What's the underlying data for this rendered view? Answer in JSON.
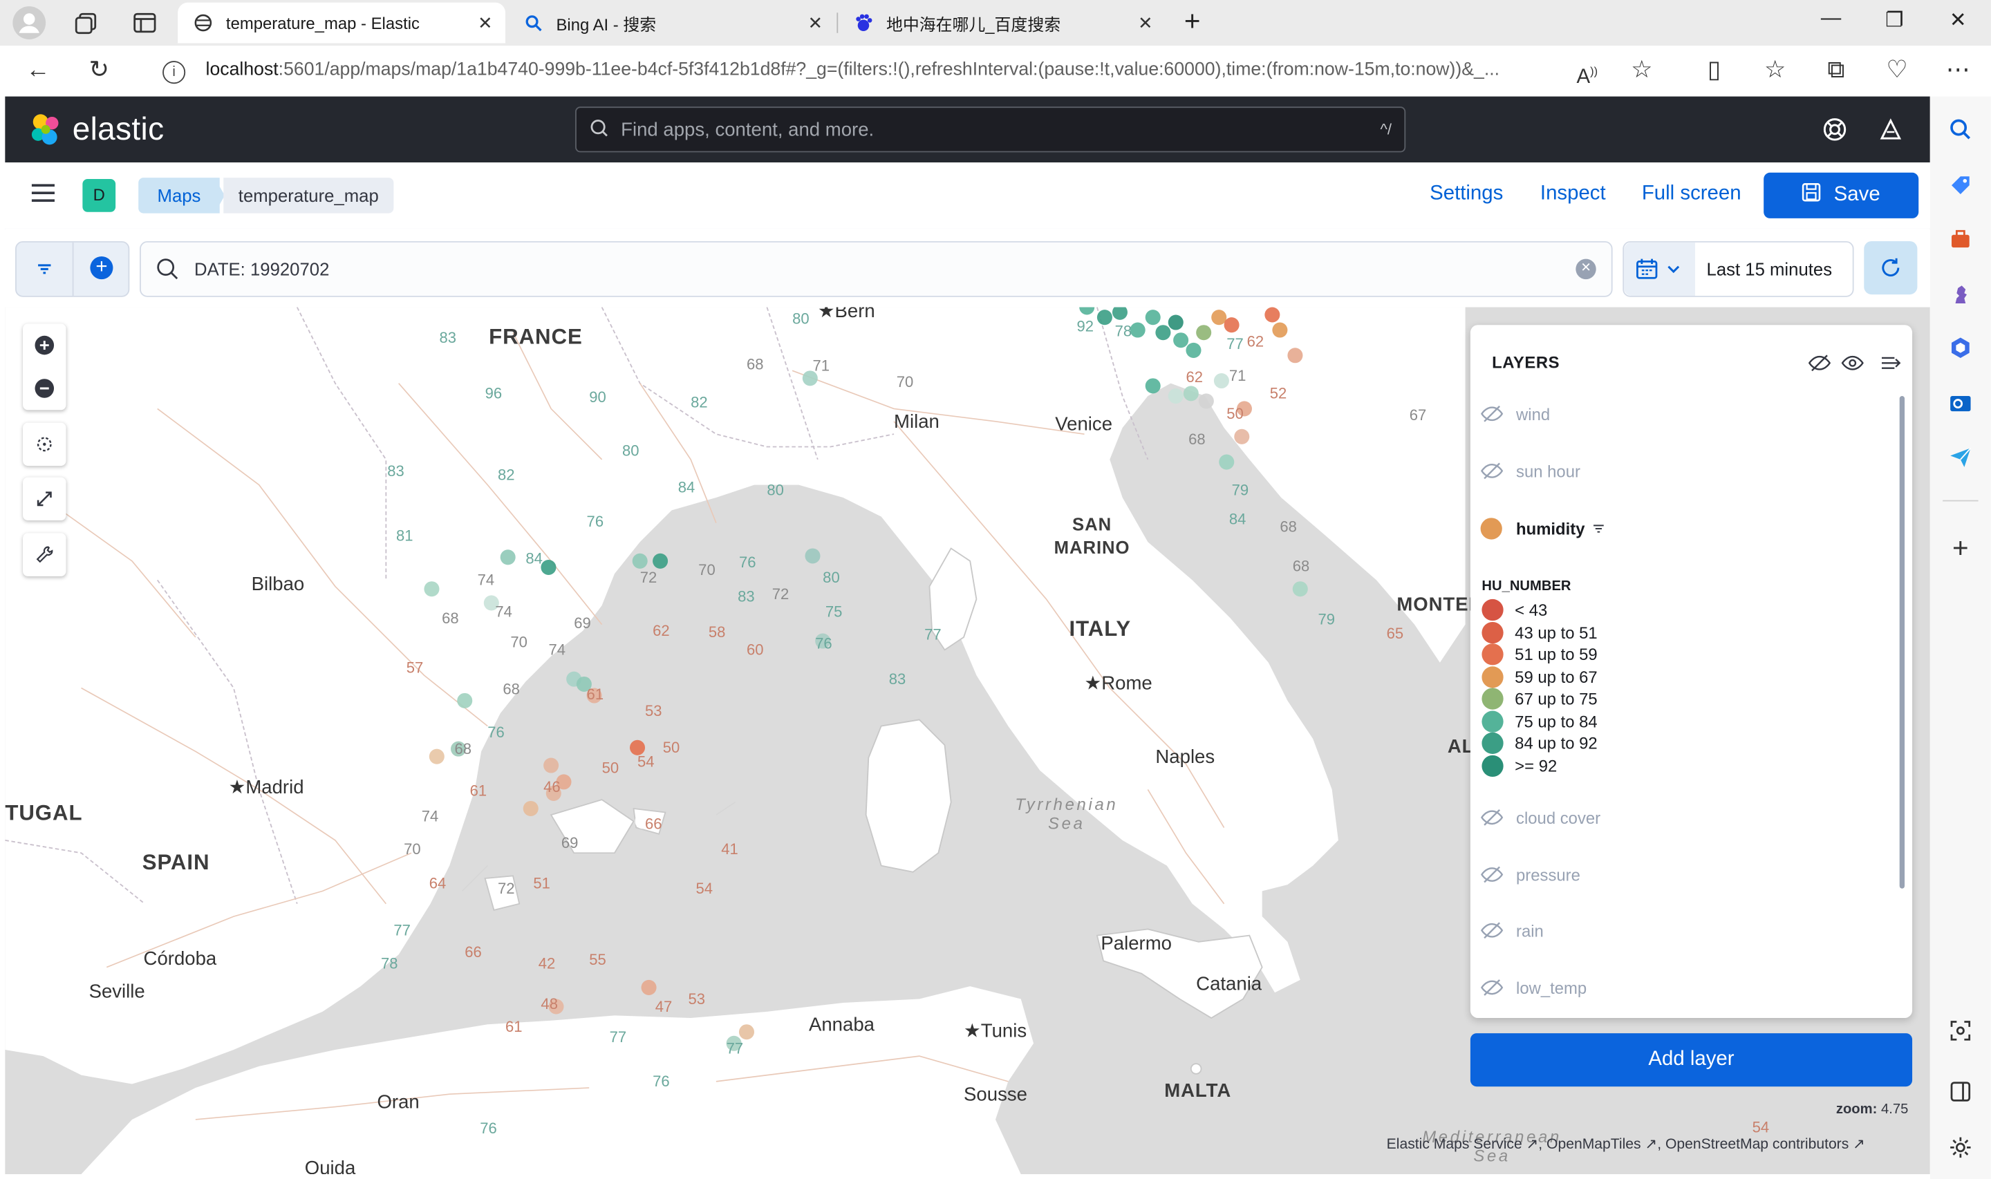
{
  "browser": {
    "tabs": [
      {
        "title": "temperature_map - Elastic",
        "active": true
      },
      {
        "title": "Bing AI - 搜索",
        "active": false
      },
      {
        "title": "地中海在哪儿_百度搜索",
        "active": false
      }
    ],
    "url_host": "localhost",
    "url_rest": ":5601/app/maps/map/1a1b4740-999b-11ee-b4cf-5f3f412b1d8f#?_g=(filters:!(),refreshInterval:(pause:!t,value:60000),time:(from:now-15m,to:now))&_..."
  },
  "kibana": {
    "brand": "elastic",
    "search_placeholder": "Find apps, content, and more.",
    "search_shortcut": "^/",
    "space_initial": "D",
    "breadcrumbs": [
      "Maps",
      "temperature_map"
    ],
    "actions": {
      "settings": "Settings",
      "inspect": "Inspect",
      "fullscreen": "Full screen",
      "save": "Save"
    },
    "query": "DATE: 19920702",
    "time_range": "Last 15 minutes",
    "accent": "#0b64dd"
  },
  "map": {
    "places": [
      {
        "name": "FRANCE",
        "big": true
      },
      {
        "name": "Bern"
      },
      {
        "name": "Milan"
      },
      {
        "name": "Venice"
      },
      {
        "name": "SAN MARINO",
        "big": true
      },
      {
        "name": "ITALY",
        "big": true
      },
      {
        "name": "Rome"
      },
      {
        "name": "Naples"
      },
      {
        "name": "MONTEN",
        "big": true
      },
      {
        "name": "AL",
        "big": true
      },
      {
        "name": "Bilbao"
      },
      {
        "name": "Madrid"
      },
      {
        "name": "TUGAL",
        "big": true
      },
      {
        "name": "SPAIN",
        "big": true
      },
      {
        "name": "Córdoba"
      },
      {
        "name": "Seville"
      },
      {
        "name": "Oran"
      },
      {
        "name": "Oujda"
      },
      {
        "name": "Annaba"
      },
      {
        "name": "Tunis"
      },
      {
        "name": "Sousse"
      },
      {
        "name": "Palermo"
      },
      {
        "name": "Catania"
      },
      {
        "name": "MALTA",
        "big": true
      }
    ],
    "seas": [
      {
        "name": "Tyrrhenian Sea"
      },
      {
        "name": "Mediterranean Sea"
      }
    ],
    "numbers": [
      "83",
      "80",
      "96",
      "90",
      "82",
      "68",
      "71",
      "70",
      "81",
      "83",
      "82",
      "80",
      "84",
      "80",
      "76",
      "84",
      "74",
      "68",
      "74",
      "70",
      "74",
      "69",
      "72",
      "70",
      "76",
      "83",
      "72",
      "80",
      "75",
      "62",
      "58",
      "60",
      "76",
      "77",
      "83",
      "57",
      "68",
      "61",
      "53",
      "50",
      "54",
      "50",
      "68",
      "76",
      "74",
      "61",
      "46",
      "69",
      "66",
      "41",
      "70",
      "64",
      "72",
      "51",
      "54",
      "77",
      "78",
      "66",
      "42",
      "55",
      "48",
      "47",
      "53",
      "61",
      "77",
      "77",
      "76",
      "76",
      "62",
      "71",
      "50",
      "52",
      "67",
      "68",
      "79",
      "84",
      "68",
      "68",
      "79",
      "65",
      "78",
      "77",
      "62",
      "92",
      "54"
    ],
    "zoom_label": "zoom:",
    "zoom_value": "4.75",
    "attribution": [
      "Elastic Maps Service",
      "OpenMapTiles",
      "OpenStreetMap contributors"
    ]
  },
  "layers_panel": {
    "title": "LAYERS",
    "layers": [
      {
        "name": "wind",
        "visible": false
      },
      {
        "name": "sun hour",
        "visible": false
      },
      {
        "name": "humidity",
        "visible": true
      },
      {
        "name": "cloud cover",
        "visible": false
      },
      {
        "name": "pressure",
        "visible": false
      },
      {
        "name": "rain",
        "visible": false
      },
      {
        "name": "low_temp",
        "visible": false
      }
    ],
    "legend_title": "HU_NUMBER",
    "legend": [
      {
        "label": "< 43",
        "color": "#d65443"
      },
      {
        "label": "43 up to 51",
        "color": "#dc6046"
      },
      {
        "label": "51 up to 59",
        "color": "#e4704e"
      },
      {
        "label": "59 up to 67",
        "color": "#e29a55"
      },
      {
        "label": "67 up to 75",
        "color": "#8fb573"
      },
      {
        "label": "75 up to 84",
        "color": "#54b399"
      },
      {
        "label": "84 up to 92",
        "color": "#3b9e85"
      },
      {
        "label": ">= 92",
        "color": "#2a8f77"
      }
    ],
    "add_layer": "Add layer"
  }
}
